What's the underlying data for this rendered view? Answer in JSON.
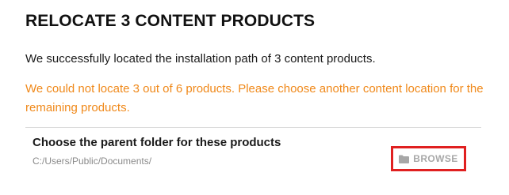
{
  "dialog": {
    "title": "RELOCATE 3 CONTENT PRODUCTS",
    "success_message": "We successfully located the installation path of 3 content products.",
    "warning_message": "We could not locate 3 out of 6 products. Please choose another content location for the remaining products.",
    "folder_section": {
      "label": "Choose the parent folder for these products",
      "path": "C:/Users/Public/Documents/",
      "browse_button": {
        "icon": "folder-icon",
        "label": "BROWSE"
      }
    }
  },
  "colors": {
    "warning": "#f0891a",
    "highlight": "#e02020",
    "browse_disabled": "#a7a7a7"
  }
}
